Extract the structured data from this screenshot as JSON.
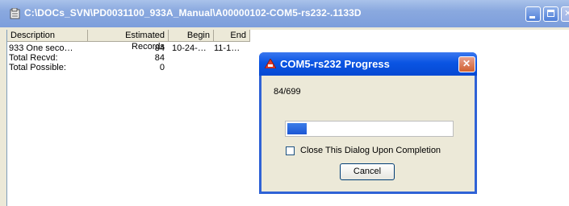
{
  "window": {
    "title": "C:\\DOCs_SVN\\PD0031100_933A_Manual\\A00000102-COM5-rs232-.1133D"
  },
  "table": {
    "columns": [
      "Description",
      "Estimated Records",
      "Begin",
      "End"
    ],
    "rows": [
      [
        "933 One seco…",
        "84",
        "10-24-…",
        "11-1…"
      ],
      [
        "Total Recvd:",
        "84",
        "",
        ""
      ],
      [
        "Total Possible:",
        "0",
        "",
        ""
      ]
    ]
  },
  "dialog": {
    "title": "COM5-rs232 Progress",
    "count_text": "84/699",
    "progress_fraction": 0.12,
    "checkbox_label": "Close This Dialog Upon Completion",
    "checkbox_checked": false,
    "cancel_label": "Cancel"
  },
  "icons": {
    "app": "document-icon",
    "dialog": "warning-icon"
  },
  "colors": {
    "title_bar_active": "#0a54e3",
    "title_bar_inactive": "#7d9edc",
    "progress": "#1c57d4"
  }
}
